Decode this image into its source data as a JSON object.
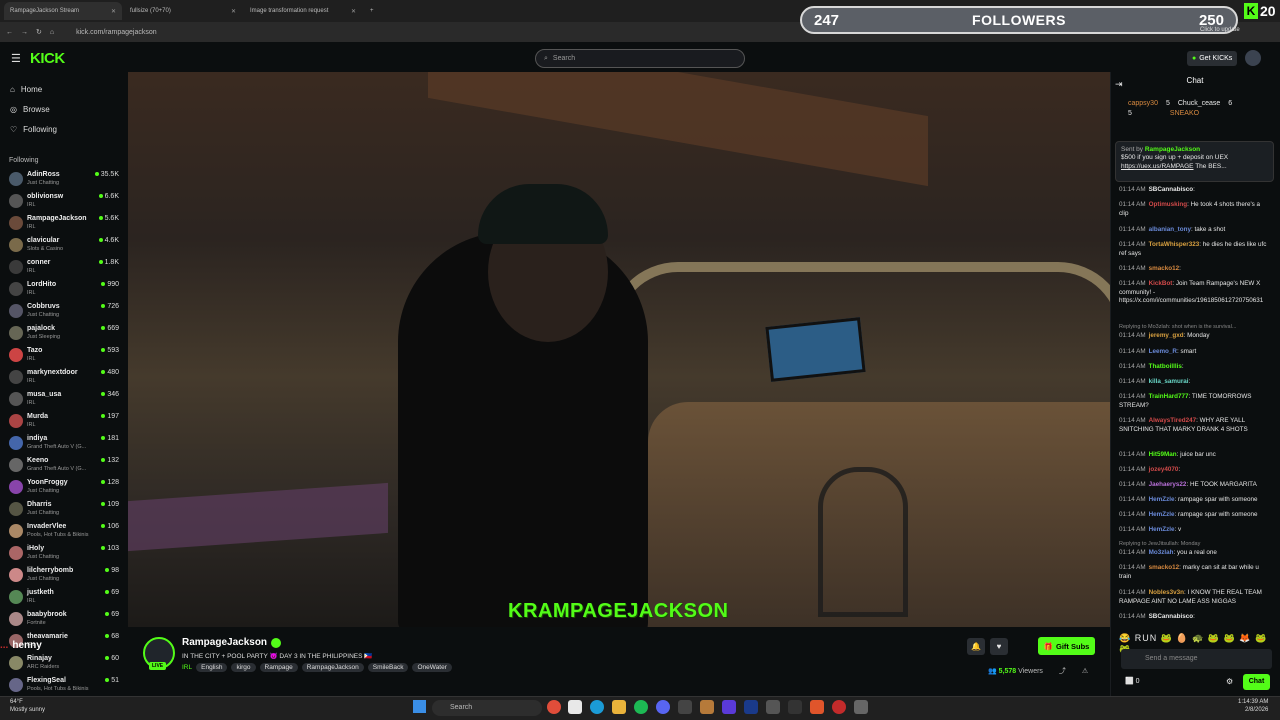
{
  "browser": {
    "tabs": [
      "RampageJackson Stream",
      "fullsize (70+70)",
      "Image transformation request"
    ],
    "url": "kick.com/rampagejackson"
  },
  "overlay": {
    "followers_left": "247",
    "followers_label": "FOLLOWERS",
    "followers_right": "250",
    "kick_badge": "20",
    "update_text": "Click to update",
    "henny_text": "henny",
    "henny_user": "..."
  },
  "header": {
    "logo": "KICK",
    "search_placeholder": "Search",
    "get_kicks": "Get KICKs"
  },
  "sidebar": {
    "nav": [
      "Home",
      "Browse",
      "Following"
    ],
    "following_title": "Following",
    "following": [
      {
        "name": "AdinRoss",
        "cat": "Just Chatting",
        "viewers": "35.5K",
        "color": "#4a5a6a"
      },
      {
        "name": "oblivionsw",
        "cat": "IRL",
        "viewers": "6.6K",
        "color": "#555"
      },
      {
        "name": "RampageJackson",
        "cat": "IRL",
        "viewers": "5.6K",
        "color": "#6a4a3a"
      },
      {
        "name": "clavicular",
        "cat": "Slots & Casino",
        "viewers": "4.6K",
        "color": "#7a6a4a"
      },
      {
        "name": "conner",
        "cat": "IRL",
        "viewers": "1.8K",
        "color": "#3a3a3a"
      },
      {
        "name": "LordHito",
        "cat": "IRL",
        "viewers": "990",
        "color": "#444"
      },
      {
        "name": "Cobbruvs",
        "cat": "Just Chatting",
        "viewers": "726",
        "color": "#556"
      },
      {
        "name": "pajalock",
        "cat": "Just Sleeping",
        "viewers": "669",
        "color": "#665"
      },
      {
        "name": "Tazo",
        "cat": "IRL",
        "viewers": "593",
        "color": "#c44"
      },
      {
        "name": "markynextdoor",
        "cat": "IRL",
        "viewers": "480",
        "color": "#444"
      },
      {
        "name": "musa_usa",
        "cat": "IRL",
        "viewers": "346",
        "color": "#555"
      },
      {
        "name": "Murda",
        "cat": "IRL",
        "viewers": "197",
        "color": "#a44"
      },
      {
        "name": "indiya",
        "cat": "Grand Theft Auto V (G...",
        "viewers": "181",
        "color": "#46a"
      },
      {
        "name": "Keeno",
        "cat": "Grand Theft Auto V (G...",
        "viewers": "132",
        "color": "#666"
      },
      {
        "name": "YoonFroggy",
        "cat": "Just Chatting",
        "viewers": "128",
        "color": "#84a"
      },
      {
        "name": "Dharris",
        "cat": "Just Chatting",
        "viewers": "109",
        "color": "#554"
      },
      {
        "name": "InvaderVlee",
        "cat": "Pools, Hot Tubs & Bikinis",
        "viewers": "106",
        "color": "#a86"
      },
      {
        "name": "iHoly",
        "cat": "Just Chatting",
        "viewers": "103",
        "color": "#a66"
      },
      {
        "name": "lilcherrybomb",
        "cat": "Just Chatting",
        "viewers": "98",
        "color": "#c88"
      },
      {
        "name": "justketh",
        "cat": "IRL",
        "viewers": "69",
        "color": "#585"
      },
      {
        "name": "baabybrook",
        "cat": "Fortnite",
        "viewers": "69",
        "color": "#a88"
      },
      {
        "name": "theavamarie",
        "cat": "IRL",
        "viewers": "68",
        "color": "#966"
      },
      {
        "name": "Rinajay",
        "cat": "ARC Raiders",
        "viewers": "60",
        "color": "#886"
      },
      {
        "name": "FlexingSeal",
        "cat": "Pools, Hot Tubs & Bikinis",
        "viewers": "51",
        "color": "#668"
      }
    ]
  },
  "video": {
    "watermark": "KRAMPAGEJACKSON"
  },
  "stream": {
    "name": "RampageJackson",
    "live": "LIVE",
    "title": "IN THE CITY + POOL PARTY 😈 DAY 3 IN THE PHILIPPINES 🇵🇭",
    "category": "IRL",
    "tags": [
      "English",
      "kirgo",
      "Rampage",
      "RampageJackson",
      "SmileBack",
      "OneWater"
    ],
    "viewers": "5,578",
    "viewers_label": "Viewers",
    "gift_subs": "Gift Subs"
  },
  "chat": {
    "title": "Chat",
    "leaders": [
      "cappsy30",
      "Chuck_cease",
      "SNEAKO"
    ],
    "leader_counts": [
      "5",
      "6",
      "5"
    ],
    "pinned_by": "Sent by",
    "pinned_user": "RampageJackson",
    "pinned_text": "$500 if you sign up + deposit on UEX",
    "pinned_link": "https://uex.us/RAMPAGE",
    "pinned_tail": "The BES...",
    "messages": [
      {
        "ts": "01:14 AM",
        "user": "SBCannabisco",
        "color": "#e6e6e6",
        "text": ""
      },
      {
        "ts": "01:14 AM",
        "user": "Optimusking",
        "color": "#d24a4a",
        "text": "He took 4 shots there's a clip"
      },
      {
        "ts": "01:14 AM",
        "user": "albanian_tony",
        "color": "#6a8ad8",
        "text": "take a shot"
      },
      {
        "ts": "01:14 AM",
        "user": "TortaWhisper323",
        "color": "#d8a040",
        "text": "he dies he dies like ufc ref says"
      },
      {
        "ts": "01:14 AM",
        "user": "smacko12",
        "color": "#d88a40",
        "text": ""
      },
      {
        "ts": "01:14 AM",
        "user": "KickBot",
        "color": "#d24a4a",
        "text": "Join Team Rampage's NEW X community! - https://x.com/i/communities/1961850612720750631"
      },
      {
        "ts": "01:14 AM",
        "user": "jeremy_gxd",
        "color": "#d8a040",
        "text": "Monday"
      },
      {
        "ts": "01:14 AM",
        "user": "Leemo_R",
        "color": "#6a8ad8",
        "text": "smart"
      },
      {
        "ts": "01:14 AM",
        "user": "Thatboilllis",
        "color": "#53fc18",
        "text": ""
      },
      {
        "ts": "01:14 AM",
        "user": "killa_samurai",
        "color": "#6ad8c8",
        "text": ""
      },
      {
        "ts": "01:14 AM",
        "user": "TrainHard777",
        "color": "#53fc18",
        "text": "TIME TOMORROWS STREAM?"
      },
      {
        "ts": "01:14 AM",
        "user": "AlwaysTired247",
        "color": "#d24a4a",
        "text": "WHY ARE YALL SNITCHING THAT MARKY DRANK 4 SHOTS"
      },
      {
        "ts": "01:14 AM",
        "user": "Hit59Man",
        "color": "#53fc18",
        "text": "juice bar unc"
      },
      {
        "ts": "01:14 AM",
        "user": "jozey4070",
        "color": "#d24a4a",
        "text": ""
      },
      {
        "ts": "01:14 AM",
        "user": "Jaehaerys22",
        "color": "#b870d8",
        "text": "HE TOOK MARGARITA"
      },
      {
        "ts": "01:14 AM",
        "user": "HemZzle",
        "color": "#6a8ad8",
        "text": "rampage spar with someone"
      },
      {
        "ts": "01:14 AM",
        "user": "HemZzle",
        "color": "#6a8ad8",
        "text": "rampage spar with someone"
      },
      {
        "ts": "01:14 AM",
        "user": "HemZzle",
        "color": "#6a8ad8",
        "text": "v"
      },
      {
        "ts": "01:14 AM",
        "user": "Mo3zlah",
        "color": "#6a8ad8",
        "text": "you a real one"
      },
      {
        "ts": "01:14 AM",
        "user": "smacko12",
        "color": "#d88a40",
        "text": "marky can sit at bar while u train"
      },
      {
        "ts": "01:14 AM",
        "user": "Nobles3v3n",
        "color": "#d8a040",
        "text": "I KNOW THE REAL TEAM RAMPAGE AINT NO LAME ASS NIGGAS"
      },
      {
        "ts": "01:14 AM",
        "user": "SBCannabisco",
        "color": "#e6e6e6",
        "text": ""
      }
    ],
    "reply1": "Replying to Mo3zlah: shot when is the survival...",
    "reply2": "Replying to JewJitsullah: Monday",
    "send_placeholder": "Send a message",
    "send_button": "Chat",
    "count": "0",
    "emotes": "😂 RUN 🐸 🥚 🐢 🐸 🐸 🦊 🐸 🐸"
  },
  "taskbar": {
    "weather_temp": "64°F",
    "weather_desc": "Mostly sunny",
    "search": "Search",
    "time": "1:14:39 AM",
    "date": "2/8/2026"
  }
}
